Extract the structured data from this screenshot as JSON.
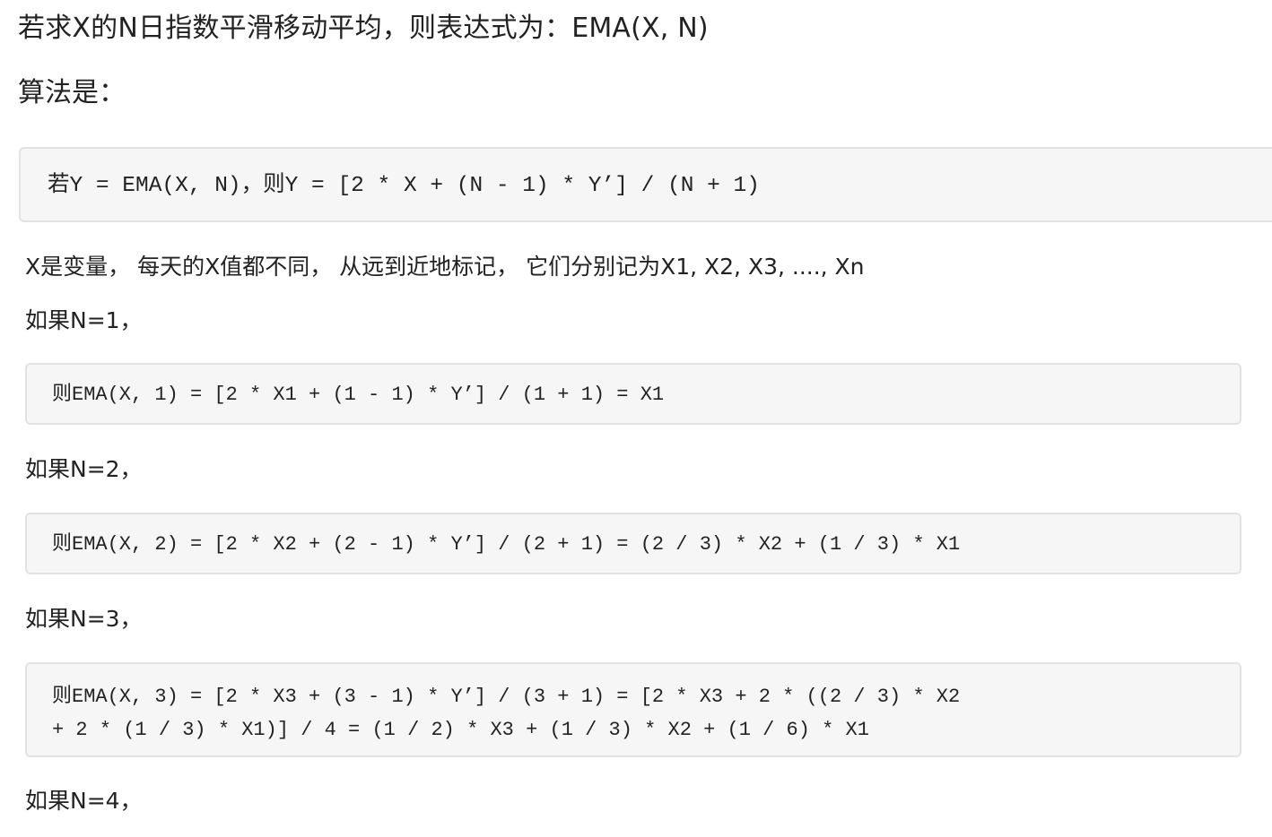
{
  "intro": "若求X的N日指数平滑移动平均，则表达式为：EMA(X, N)",
  "algorithm_label": "算法是：",
  "main_formula": "若Y = EMA(X, N)，则Y = [2 * X + (N - 1) * Y’] / (N + 1)",
  "x_description": "X是变量， 每天的X值都不同， 从远到近地标记， 它们分别记为X1, X2, X3, ...., Xn",
  "cases": [
    {
      "condition": "如果N=1，",
      "lines": [
        "则EMA(X, 1) = [2 * X1 + (1 - 1) * Y’] / (1 + 1) = X1"
      ]
    },
    {
      "condition": "如果N=2，",
      "lines": [
        "则EMA(X, 2) = [2 * X2 + (2 - 1) * Y’] / (2 + 1) = (2 / 3) * X2 + (1 / 3) * X1"
      ]
    },
    {
      "condition": "如果N=3，",
      "lines": [
        "则EMA(X, 3) = [2 * X3 + (3 - 1) * Y’] / (3 + 1) = [2 * X3 + 2 * ((2 / 3) * X2",
        "+ 2 * (1 / 3) * X1)] / 4 = (1 / 2) * X3 + (1 / 3) * X2 + (1 / 6) * X1"
      ]
    },
    {
      "condition": "如果N=4，"
    }
  ]
}
